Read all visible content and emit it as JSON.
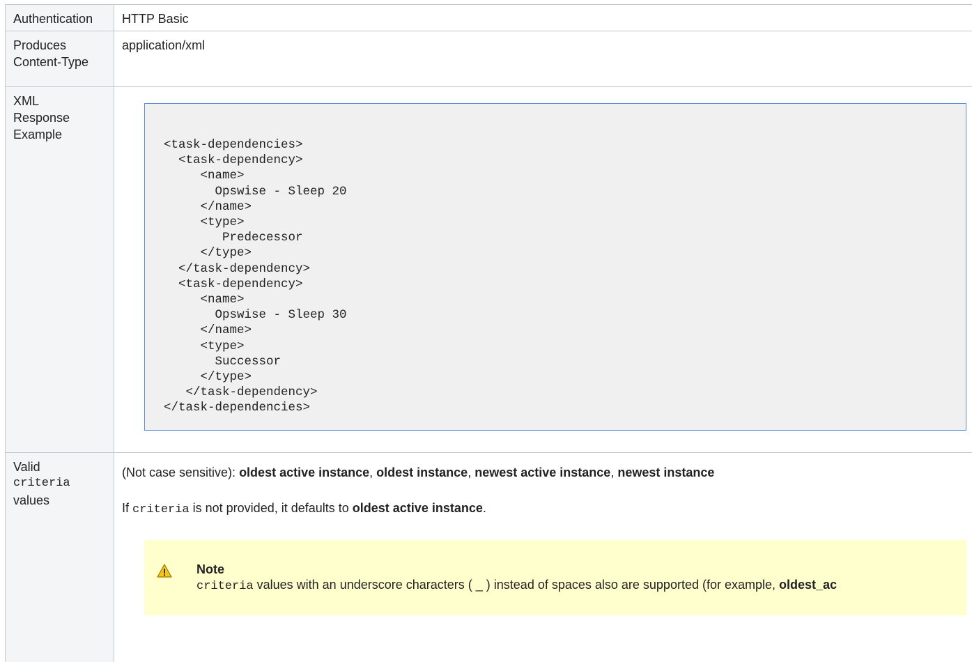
{
  "rows": {
    "authentication": {
      "label": "Authentication",
      "value": "HTTP Basic"
    },
    "produces": {
      "label_line1": "Produces",
      "label_line2": "Content-Type",
      "value": "application/xml"
    },
    "xml_example": {
      "label_line1": "XML",
      "label_line2": "Response",
      "label_line3": "Example",
      "code": "<task-dependencies>\n  <task-dependency>\n     <name>\n       Opswise - Sleep 20\n     </name>\n     <type>\n        Predecessor\n     </type>\n  </task-dependency>\n  <task-dependency>\n     <name>\n       Opswise - Sleep 30\n     </name>\n     <type>\n       Successor\n     </type>\n   </task-dependency>\n</task-dependencies>"
    },
    "criteria": {
      "label_line1": "Valid",
      "label_code": "criteria",
      "label_line3": "values",
      "intro": "(Not case sensitive): ",
      "v1": "oldest active instance",
      "sep1": ", ",
      "v2": "oldest instance",
      "sep2": ", ",
      "v3": "newest active instance",
      "sep3": ", ",
      "v4": "newest instance",
      "default_pre": "If ",
      "default_code": "criteria",
      "default_mid": " is not provided, it defaults to ",
      "default_bold": "oldest active instance",
      "default_end": "."
    }
  },
  "note": {
    "icon": "warning-icon",
    "title": "Note",
    "body_code": "criteria",
    "body_text": " values with an underscore characters ( _ ) instead of spaces also are supported (for example, ",
    "body_bold": "oldest_ac"
  },
  "colors": {
    "label_bg": "#f4f5f7",
    "code_bg": "#f0f0f0",
    "code_border": "#5b8fd6",
    "note_bg": "#ffffce",
    "grid": "#c1c7d0"
  }
}
